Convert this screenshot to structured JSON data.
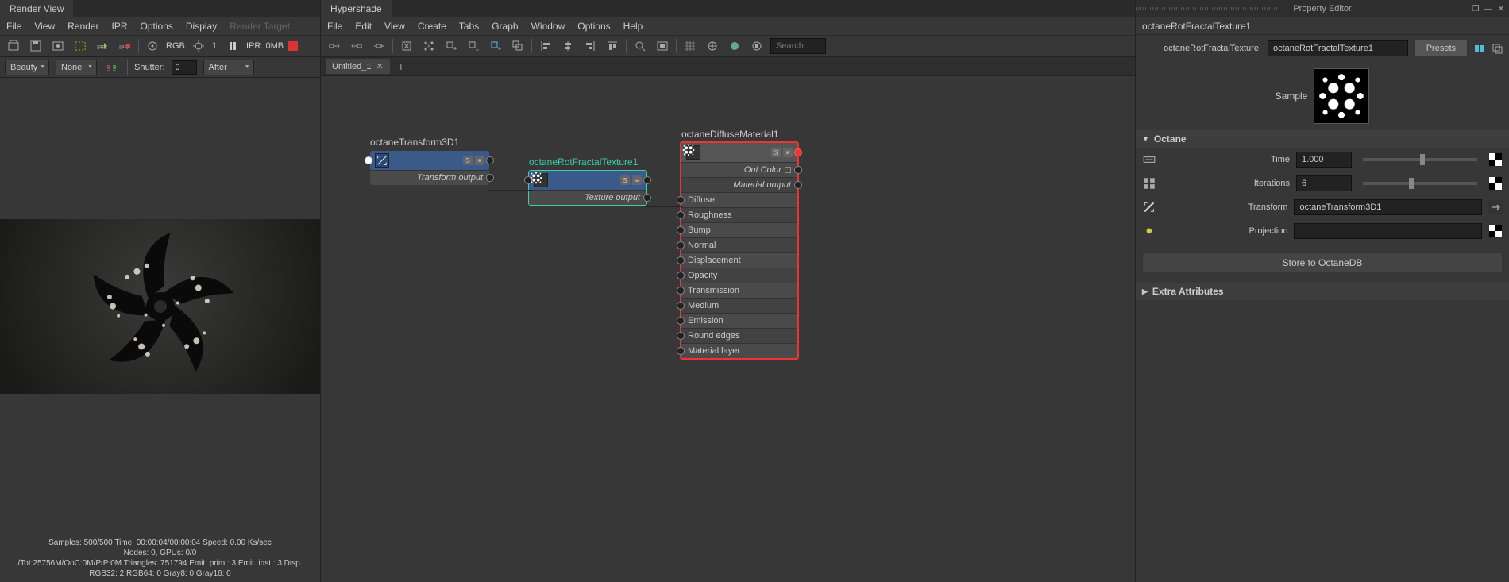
{
  "renderView": {
    "title": "Render View",
    "menu": [
      "File",
      "View",
      "Render",
      "IPR",
      "Options",
      "Display",
      "Render Target"
    ],
    "rgb": "RGB",
    "frame": "1:",
    "iprMem": "IPR: 0MB",
    "pass": "Beauty",
    "aov": "None",
    "shutterLabel": "Shutter:",
    "shutterVal": "0",
    "shutterMode": "After",
    "status1": "Samples: 500/500  Time: 00:00:04/00:00:04  Speed: 0.00 Ks/sec",
    "status2": "Nodes: 0, GPUs: 0/0",
    "status3": "/Tot:25756M/OoC:0M/PtP:0M  Triangles: 751794 Emit. prim.: 3 Emit. inst.: 3 Disp.",
    "status4": "RGB32: 2 RGB64: 0 Gray8: 0 Gray16: 0"
  },
  "hypershade": {
    "title": "Hypershade",
    "menu": [
      "File",
      "Edit",
      "View",
      "Create",
      "Tabs",
      "Graph",
      "Window",
      "Options",
      "Help"
    ],
    "searchPlaceholder": "Search...",
    "docTab": "Untitled_1",
    "nodes": {
      "transform": {
        "title": "octaneTransform3D1",
        "out": "Transform output"
      },
      "texture": {
        "title": "octaneRotFractalTexture1",
        "out": "Texture output"
      },
      "material": {
        "title": "octaneDiffuseMaterial1",
        "outColor": "Out Color",
        "outMat": "Material output",
        "inputs": [
          "Diffuse",
          "Roughness",
          "Bump",
          "Normal",
          "Displacement",
          "Opacity",
          "Transmission",
          "Medium",
          "Emission",
          "Round edges",
          "Material layer"
        ]
      }
    }
  },
  "propertyEditor": {
    "title": "Property Editor",
    "nodeName": "octaneRotFractalTexture1",
    "typeLabel": "octaneRotFractalTexture:",
    "nameVal": "octaneRotFractalTexture1",
    "presets": "Presets",
    "sampleLabel": "Sample",
    "octaneSection": "Octane",
    "attrs": {
      "timeLabel": "Time",
      "timeVal": "1.000",
      "iterLabel": "Iterations",
      "iterVal": "6",
      "transformLabel": "Transform",
      "transformVal": "octaneTransform3D1",
      "projectionLabel": "Projection",
      "projectionVal": ""
    },
    "storeBtn": "Store to OctaneDB",
    "extraSection": "Extra Attributes"
  }
}
